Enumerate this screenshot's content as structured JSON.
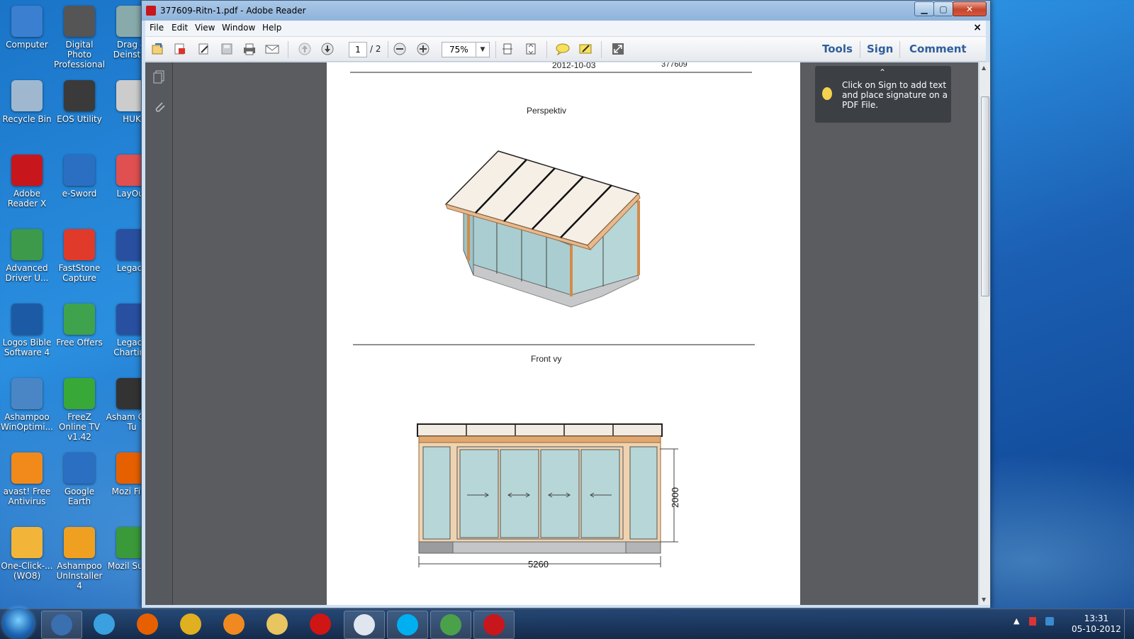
{
  "window": {
    "title": "377609-Ritn-1.pdf - Adobe Reader",
    "buttons": {
      "minimize": "▁",
      "maximize": "▢",
      "close": "✕"
    }
  },
  "menu": {
    "items": [
      "File",
      "Edit",
      "View",
      "Window",
      "Help"
    ],
    "doc_close": "×"
  },
  "toolbar": {
    "current_page": "1",
    "total_pages": "/ 2",
    "zoom": "75%",
    "right_tabs": [
      "Tools",
      "Sign",
      "Comment"
    ]
  },
  "tooltip": {
    "text": "Click on Sign to add text and place signature on a PDF File."
  },
  "document": {
    "header_date": "2012-10-03",
    "header_number": "377609",
    "section1_title": "Perspektiv",
    "section2_title": "Front vy",
    "dim_height": "2000",
    "dim_width": "5260"
  },
  "desktop_icons": [
    {
      "label": "Computer",
      "icon": "computer-icon",
      "color": "#3b7fd1"
    },
    {
      "label": "Digital Photo Professional",
      "icon": "camera-icon",
      "color": "#555555"
    },
    {
      "label": "Drag & Deinstall",
      "icon": "drag-icon",
      "color": "#8aa"
    },
    {
      "label": "Recycle Bin",
      "icon": "recycle-bin-icon",
      "color": "#9fb8d0"
    },
    {
      "label": "EOS Utility",
      "icon": "eos-icon",
      "color": "#3a3a3a"
    },
    {
      "label": "HUK",
      "icon": "huk-icon",
      "color": "#cccccc"
    },
    {
      "label": "Adobe Reader X",
      "icon": "adobe-reader-icon",
      "color": "#c8161d"
    },
    {
      "label": "e-Sword",
      "icon": "esword-icon",
      "color": "#2a6fc2"
    },
    {
      "label": "LayOut",
      "icon": "layout-icon",
      "color": "#e05050"
    },
    {
      "label": "Advanced Driver U...",
      "icon": "driver-icon",
      "color": "#3c9a4a"
    },
    {
      "label": "FastStone Capture",
      "icon": "faststone-icon",
      "color": "#e03a2a"
    },
    {
      "label": "Legacy",
      "icon": "legacy-icon",
      "color": "#2950a0"
    },
    {
      "label": "Logos Bible Software 4",
      "icon": "logos-icon",
      "color": "#1d5aa6"
    },
    {
      "label": "Free Offers",
      "icon": "gift-icon",
      "color": "#3fa34d"
    },
    {
      "label": "Legacy Charting",
      "icon": "legacy-chart-icon",
      "color": "#2950a0"
    },
    {
      "label": "Ashampoo WinOptimi...",
      "icon": "ashampoo-icon",
      "color": "#4a86c5"
    },
    {
      "label": "FreeZ Online TV v1.42",
      "icon": "freez-icon",
      "color": "#38a838"
    },
    {
      "label": "Asham Core Tu",
      "icon": "ashampoo-core-icon",
      "color": "#333333"
    },
    {
      "label": "avast! Free Antivirus",
      "icon": "avast-icon",
      "color": "#f28a1b"
    },
    {
      "label": "Google Earth",
      "icon": "google-earth-icon",
      "color": "#2a6fc2"
    },
    {
      "label": "Mozi Firef",
      "icon": "firefox-icon",
      "color": "#e66000"
    },
    {
      "label": "One-Click-... (WO8)",
      "icon": "oneclick-icon",
      "color": "#f2b53a"
    },
    {
      "label": "Ashampoo UnInstaller 4",
      "icon": "uninstaller-icon",
      "color": "#f0a020"
    },
    {
      "label": "Mozil Sunbi",
      "icon": "sunbird-icon",
      "color": "#3a9a3a"
    }
  ],
  "taskbar": {
    "apps": [
      {
        "name": "outlook-icon",
        "color": "#3a6fb0"
      },
      {
        "name": "ie-icon",
        "color": "#3aa0e0"
      },
      {
        "name": "firefox-icon",
        "color": "#e66000"
      },
      {
        "name": "chrome-icon",
        "color": "#e0b020"
      },
      {
        "name": "media-player-icon",
        "color": "#f08a20"
      },
      {
        "name": "explorer-icon",
        "color": "#e8c560"
      },
      {
        "name": "opera-icon",
        "color": "#d01515"
      },
      {
        "name": "document-icon",
        "color": "#dfe6f0"
      },
      {
        "name": "skype-icon",
        "color": "#00aff0"
      },
      {
        "name": "network-icon",
        "color": "#4aa14a"
      },
      {
        "name": "adobe-reader-icon",
        "color": "#c8161d"
      }
    ],
    "clock_time": "13:31",
    "clock_date": "05-10-2012"
  }
}
